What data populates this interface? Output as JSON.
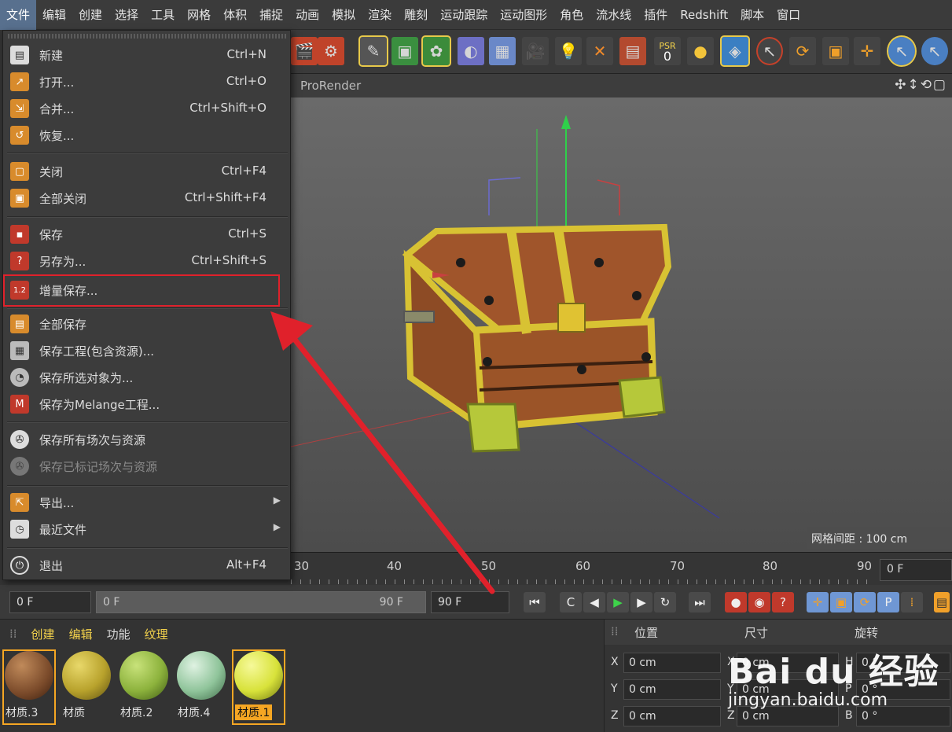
{
  "menubar": {
    "items": [
      "文件",
      "编辑",
      "创建",
      "选择",
      "工具",
      "网格",
      "体积",
      "捕捉",
      "动画",
      "模拟",
      "渲染",
      "雕刻",
      "运动跟踪",
      "运动图形",
      "角色",
      "流水线",
      "插件",
      "Redshift",
      "脚本",
      "窗口"
    ]
  },
  "toolbar": {
    "psr_label": "PSR",
    "psr_value": "0",
    "icons": [
      "clapboard-icon",
      "render-settings-icon",
      "pen-icon",
      "cube-icon",
      "subdivision-icon",
      "deformer-icon",
      "floor-icon",
      "camera-icon",
      "light-icon",
      "effector-icon",
      "tag-icon",
      "psr-icon",
      "axis-icon",
      "model-mode-icon",
      "move-icon",
      "rotate-icon",
      "scale-icon",
      "snap-icon",
      "select-icon",
      "select-live-icon"
    ]
  },
  "viewport": {
    "title": "ProRender",
    "nav_icons": "✣↕⟲▢",
    "grid_info": "网格间距 : 100 cm"
  },
  "file_menu": {
    "items": [
      {
        "label": "新建",
        "shortcut": "Ctrl+N",
        "icon": "new-file-icon"
      },
      {
        "label": "打开...",
        "shortcut": "Ctrl+O",
        "icon": "open-icon"
      },
      {
        "label": "合并...",
        "shortcut": "Ctrl+Shift+O",
        "icon": "merge-icon"
      },
      {
        "label": "恢复...",
        "shortcut": "",
        "icon": "revert-icon"
      },
      {
        "label": "关闭",
        "shortcut": "Ctrl+F4",
        "icon": "close-file-icon"
      },
      {
        "label": "全部关闭",
        "shortcut": "Ctrl+Shift+F4",
        "icon": "close-all-icon"
      },
      {
        "label": "保存",
        "shortcut": "Ctrl+S",
        "icon": "save-icon"
      },
      {
        "label": "另存为...",
        "shortcut": "Ctrl+Shift+S",
        "icon": "save-as-icon"
      },
      {
        "label": "增量保存...",
        "shortcut": "",
        "icon": "incremental-save-icon"
      },
      {
        "label": "全部保存",
        "shortcut": "",
        "icon": "save-all-icon"
      },
      {
        "label": "保存工程(包含资源)...",
        "shortcut": "",
        "icon": "save-project-icon"
      },
      {
        "label": "保存所选对象为...",
        "shortcut": "",
        "icon": "save-selected-icon"
      },
      {
        "label": "保存为Melange工程...",
        "shortcut": "",
        "icon": "save-melange-icon"
      },
      {
        "label": "保存所有场次与资源",
        "shortcut": "",
        "icon": "save-takes-icon"
      },
      {
        "label": "保存已标记场次与资源",
        "shortcut": "",
        "icon": "save-marked-takes-icon"
      },
      {
        "label": "导出...",
        "shortcut": "",
        "icon": "export-icon"
      },
      {
        "label": "最近文件",
        "shortcut": "",
        "icon": "recent-files-icon"
      },
      {
        "label": "退出",
        "shortcut": "Alt+F4",
        "icon": "exit-icon"
      }
    ]
  },
  "timeline": {
    "ticks": [
      "30",
      "40",
      "50",
      "60",
      "70",
      "80",
      "90"
    ],
    "current_frame": "0 F"
  },
  "transport": {
    "start": "0 F",
    "slider_start": "0 F",
    "slider_end": "90 F",
    "end": "90 F"
  },
  "materials": {
    "menu": [
      "创建",
      "编辑",
      "功能",
      "纹理"
    ],
    "items": [
      {
        "name": "材质.3",
        "color": "#7a4a2a"
      },
      {
        "name": "材质",
        "color": "#b8a22c"
      },
      {
        "name": "材质.2",
        "color": "#8cb23c"
      },
      {
        "name": "材质.4",
        "color": "#8fc49a"
      },
      {
        "name": "材质.1",
        "color": "#d8e23a"
      }
    ]
  },
  "coordinates": {
    "headers": [
      "位置",
      "尺寸",
      "旋转"
    ],
    "rows": [
      {
        "axis": "X",
        "pos": "0 cm",
        "size_axis": "X",
        "size": "0 cm",
        "rot_axis": "H",
        "rot": "0 °"
      },
      {
        "axis": "Y",
        "pos": "0 cm",
        "size_axis": "Y",
        "size": "0 cm",
        "rot_axis": "P",
        "rot": "0 °"
      },
      {
        "axis": "Z",
        "pos": "0 cm",
        "size_axis": "Z",
        "size": "0 cm",
        "rot_axis": "B",
        "rot": "0 °"
      }
    ]
  },
  "watermark": {
    "big": "Bai du 经验",
    "small": "jingyan.baidu.com"
  },
  "colors": {
    "accent_red": "#e0212b",
    "selected_orange": "#f5a623",
    "menu_active": "#58708e"
  }
}
